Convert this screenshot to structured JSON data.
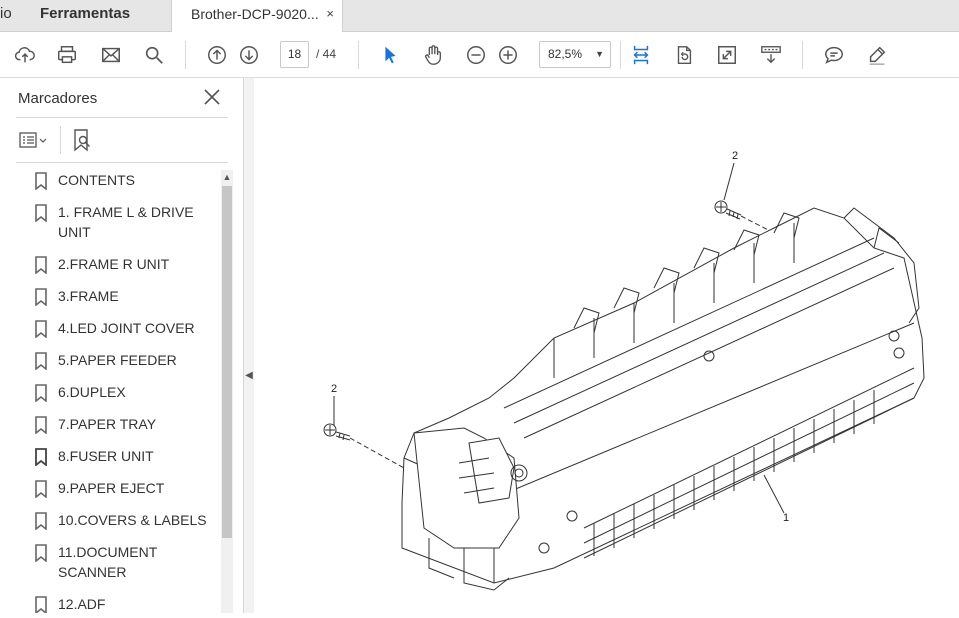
{
  "tabs": {
    "home_label": "io",
    "tools_label": "Ferramentas",
    "document_label": "Brother-DCP-9020...",
    "close_glyph": "×"
  },
  "toolbar": {
    "current_page": "18",
    "total_pages": "/ 44",
    "zoom": "82,5%",
    "icons": [
      "upload-icon",
      "print-icon",
      "mail-icon",
      "search-icon",
      "page-up-icon",
      "page-down-icon",
      "select-cursor-icon",
      "hand-tool-icon",
      "zoom-out-icon",
      "zoom-in-icon",
      "fit-width-icon",
      "rotate-page-icon",
      "fullscreen-icon",
      "scroll-mode-icon",
      "comment-icon",
      "highlight-pen-icon"
    ]
  },
  "sidebar": {
    "title": "Marcadores",
    "items": [
      {
        "label": "CONTENTS"
      },
      {
        "label": "1. FRAME L & DRIVE UNIT"
      },
      {
        "label": "2.FRAME R UNIT"
      },
      {
        "label": "3.FRAME"
      },
      {
        "label": "4.LED JOINT COVER"
      },
      {
        "label": "5.PAPER FEEDER"
      },
      {
        "label": "6.DUPLEX"
      },
      {
        "label": "7.PAPER TRAY"
      },
      {
        "label": "8.FUSER UNIT"
      },
      {
        "label": "9.PAPER EJECT"
      },
      {
        "label": "10.COVERS & LABELS"
      },
      {
        "label": "11.DOCUMENT SCANNER"
      },
      {
        "label": "12.ADF"
      }
    ]
  },
  "document": {
    "callout_top": "2",
    "callout_left": "2",
    "callout_main": "1"
  },
  "colors": {
    "accent": "#1473e6",
    "tabbar": "#e6e6e6"
  }
}
